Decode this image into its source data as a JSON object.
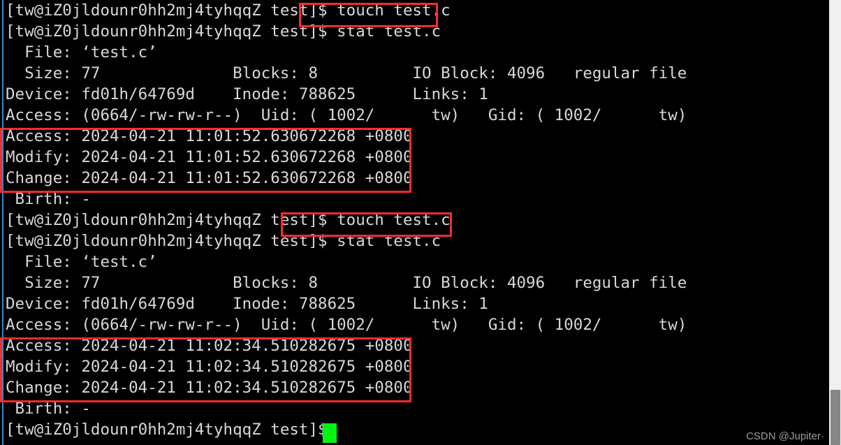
{
  "terminal": {
    "background_color": "#000000",
    "text_color": "#d8d8d8",
    "cursor_color": "#00f514",
    "accent_color": "#fb2c2c",
    "edge_color": "#3b87c8",
    "prompt": "[tw@iZ0jldounr0hh2mj4tyhqqZ test]$",
    "lines": [
      "[tw@iZ0jldounr0hh2mj4tyhqqZ test]$ touch test.c",
      "[tw@iZ0jldounr0hh2mj4tyhqqZ test]$ stat test.c",
      "  File: ‘test.c’",
      "  Size: 77              Blocks: 8          IO Block: 4096   regular file",
      "Device: fd01h/64769d    Inode: 788625      Links: 1",
      "Access: (0664/-rw-rw-r--)  Uid: ( 1002/      tw)   Gid: ( 1002/      tw)",
      "Access: 2024-04-21 11:01:52.630672268 +0800",
      "Modify: 2024-04-21 11:01:52.630672268 +0800",
      "Change: 2024-04-21 11:01:52.630672268 +0800",
      " Birth: -",
      "[tw@iZ0jldounr0hh2mj4tyhqqZ test]$ touch test.c",
      "[tw@iZ0jldounr0hh2mj4tyhqqZ test]$ stat test.c",
      "  File: ‘test.c’",
      "  Size: 77              Blocks: 8          IO Block: 4096   regular file",
      "Device: fd01h/64769d    Inode: 788625      Links: 1",
      "Access: (0664/-rw-rw-r--)  Uid: ( 1002/      tw)   Gid: ( 1002/      tw)",
      "Access: 2024-04-21 11:02:34.510282675 +0800",
      "Modify: 2024-04-21 11:02:34.510282675 +0800",
      "Change: 2024-04-21 11:02:34.510282675 +0800",
      " Birth: -",
      "[tw@iZ0jldounr0hh2mj4tyhqqZ test]$"
    ],
    "commands": {
      "touch": "touch test.c",
      "stat": "stat test.c"
    },
    "stat_blocks": [
      {
        "file": "‘test.c’",
        "size": "77",
        "blocks": "8",
        "io_block": "4096",
        "file_type": "regular file",
        "device": "fd01h/64769d",
        "inode": "788625",
        "links": "1",
        "permissions": "(0664/-rw-rw-r--)",
        "uid": "( 1002/      tw)",
        "gid": "( 1002/      tw)",
        "access_time": "2024-04-21 11:01:52.630672268 +0800",
        "modify_time": "2024-04-21 11:01:52.630672268 +0800",
        "change_time": "2024-04-21 11:01:52.630672268 +0800",
        "birth_time": "-"
      },
      {
        "file": "‘test.c’",
        "size": "77",
        "blocks": "8",
        "io_block": "4096",
        "file_type": "regular file",
        "device": "fd01h/64769d",
        "inode": "788625",
        "links": "1",
        "permissions": "(0664/-rw-rw-r--)",
        "uid": "( 1002/      tw)",
        "gid": "( 1002/      tw)",
        "access_time": "2024-04-21 11:02:34.510282675 +0800",
        "modify_time": "2024-04-21 11:02:34.510282675 +0800",
        "change_time": "2024-04-21 11:02:34.510282675 +0800",
        "birth_time": "-"
      }
    ]
  },
  "annotations": {
    "highlight_color": "#fb2c2c",
    "boxes": [
      {
        "label": "touch-command-1"
      },
      {
        "label": "timestamps-1"
      },
      {
        "label": "touch-command-2"
      },
      {
        "label": "timestamps-2"
      }
    ]
  },
  "watermark": {
    "text": "CSDN @Jupiter·"
  },
  "scrollbar": {
    "track_color": "#f0f0f0",
    "thumb_color": "#868686"
  }
}
